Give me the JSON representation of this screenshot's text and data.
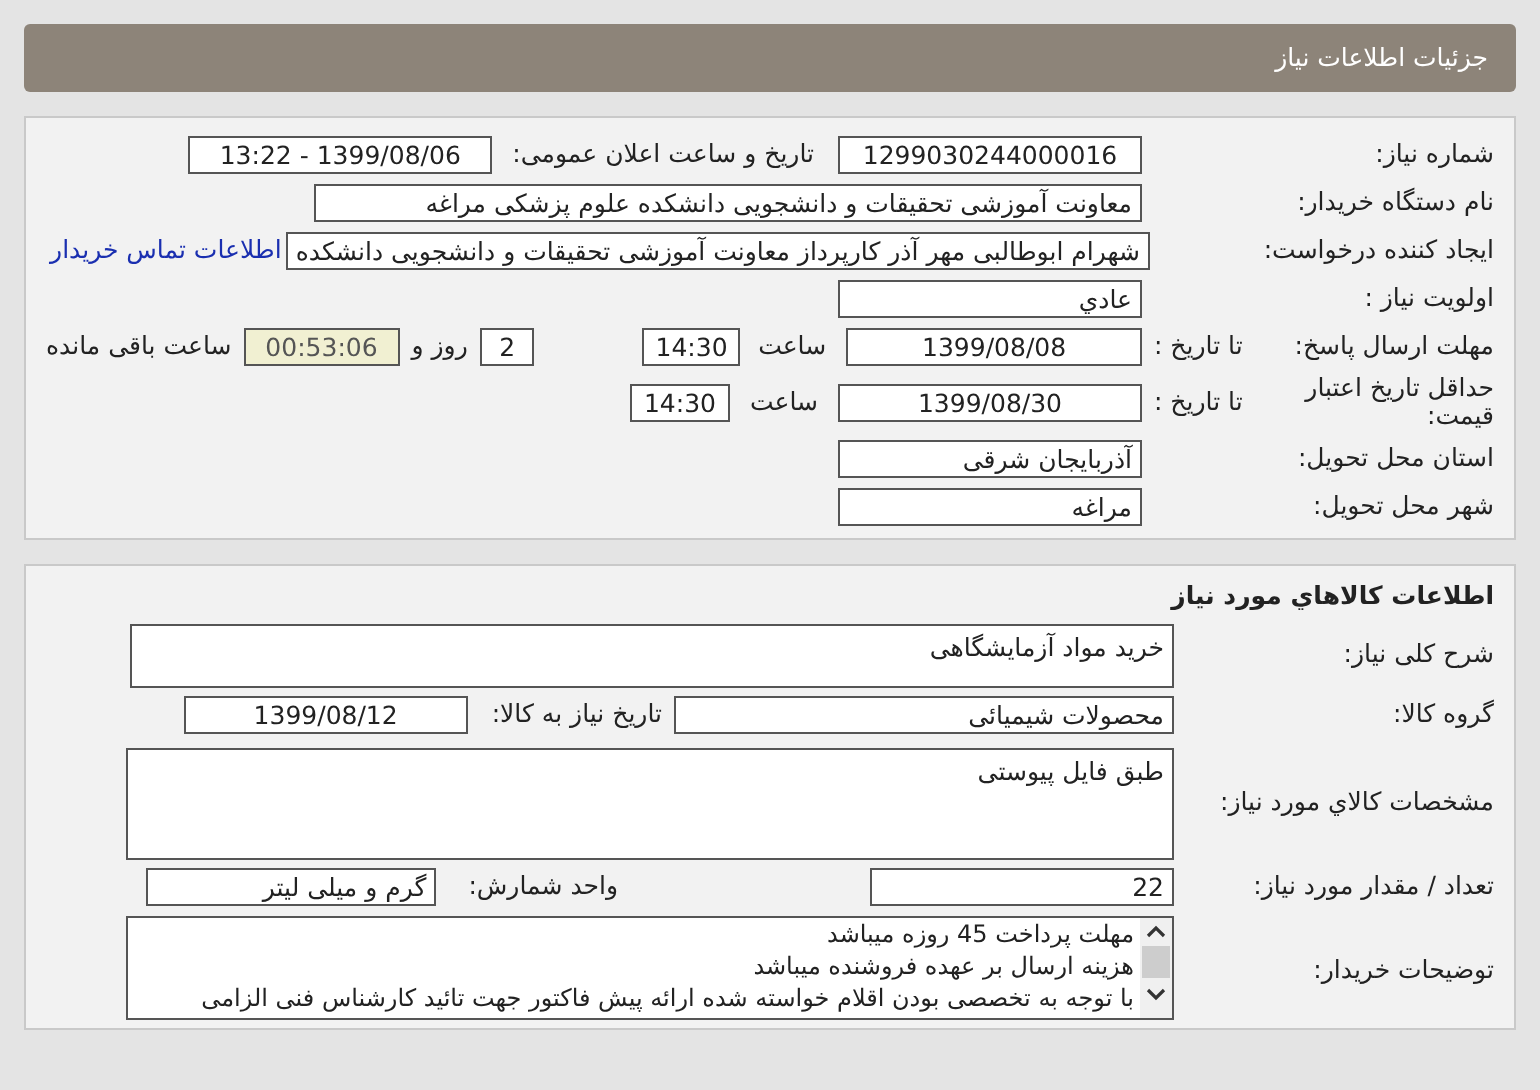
{
  "header": {
    "title": "جزئیات اطلاعات نیاز"
  },
  "need_info": {
    "need_number": {
      "label": "شماره نیاز:",
      "value": "1299030244000016"
    },
    "announce": {
      "label": "تاریخ و ساعت اعلان عمومی:",
      "value": "1399/08/06 - 13:22"
    },
    "buyer_org": {
      "label": "نام دستگاه خریدار:",
      "value": "معاونت آموزشی تحقیقات و دانشجویی دانشکده علوم پزشکی مراغه"
    },
    "requester": {
      "label": "ایجاد کننده درخواست:",
      "value": "شهرام ابوطالبی مهر آذر کارپرداز معاونت آموزشی تحقیقات و دانشجویی دانشکده",
      "link": "اطلاعات تماس خریدار"
    },
    "priority": {
      "label": "اولویت نیاز :",
      "value": "عادي"
    },
    "reply_deadline": {
      "label": "مهلت ارسال پاسخ:",
      "to_date_label": "تا تاریخ :",
      "date": "1399/08/08",
      "time_label": "ساعت",
      "time": "14:30",
      "days": "2",
      "days_label": "روز و",
      "remaining": "00:53:06",
      "remaining_label": "ساعت باقی مانده"
    },
    "price_validity": {
      "label": "حداقل تاریخ اعتبار قیمت:",
      "to_date_label": "تا تاریخ :",
      "date": "1399/08/30",
      "time_label": "ساعت",
      "time": "14:30"
    },
    "province": {
      "label": "استان محل تحویل:",
      "value": "آذربایجان شرقی"
    },
    "city": {
      "label": "شهر محل تحویل:",
      "value": "مراغه"
    }
  },
  "goods_info": {
    "title": "اطلاعات کالاهاي مورد نياز",
    "description": {
      "label": "شرح کلی نیاز:",
      "value": "خرید مواد آزمایشگاهی"
    },
    "group": {
      "label": "گروه کالا:",
      "value": "محصولات شیمیائی",
      "date_label": "تاریخ نیاز به کالا:",
      "date": "1399/08/12"
    },
    "specs": {
      "label": "مشخصات كالاي مورد نياز:",
      "value": "طبق فایل پیوستی"
    },
    "quantity": {
      "label": "تعداد / مقدار مورد نیاز:",
      "value": "22",
      "unit_label": "واحد شمارش:",
      "unit": "گرم و میلی لیتر"
    },
    "buyer_notes": {
      "label": "توضیحات خریدار:",
      "lines": [
        "مهلت پرداخت 45 روزه میباشد",
        "هزینه ارسال بر عهده فروشنده میباشد",
        "با توجه به تخصصی بودن اقلام خواسته شده ارائه پیش فاکتور جهت تائید کارشناس فنی الزامی"
      ]
    }
  }
}
